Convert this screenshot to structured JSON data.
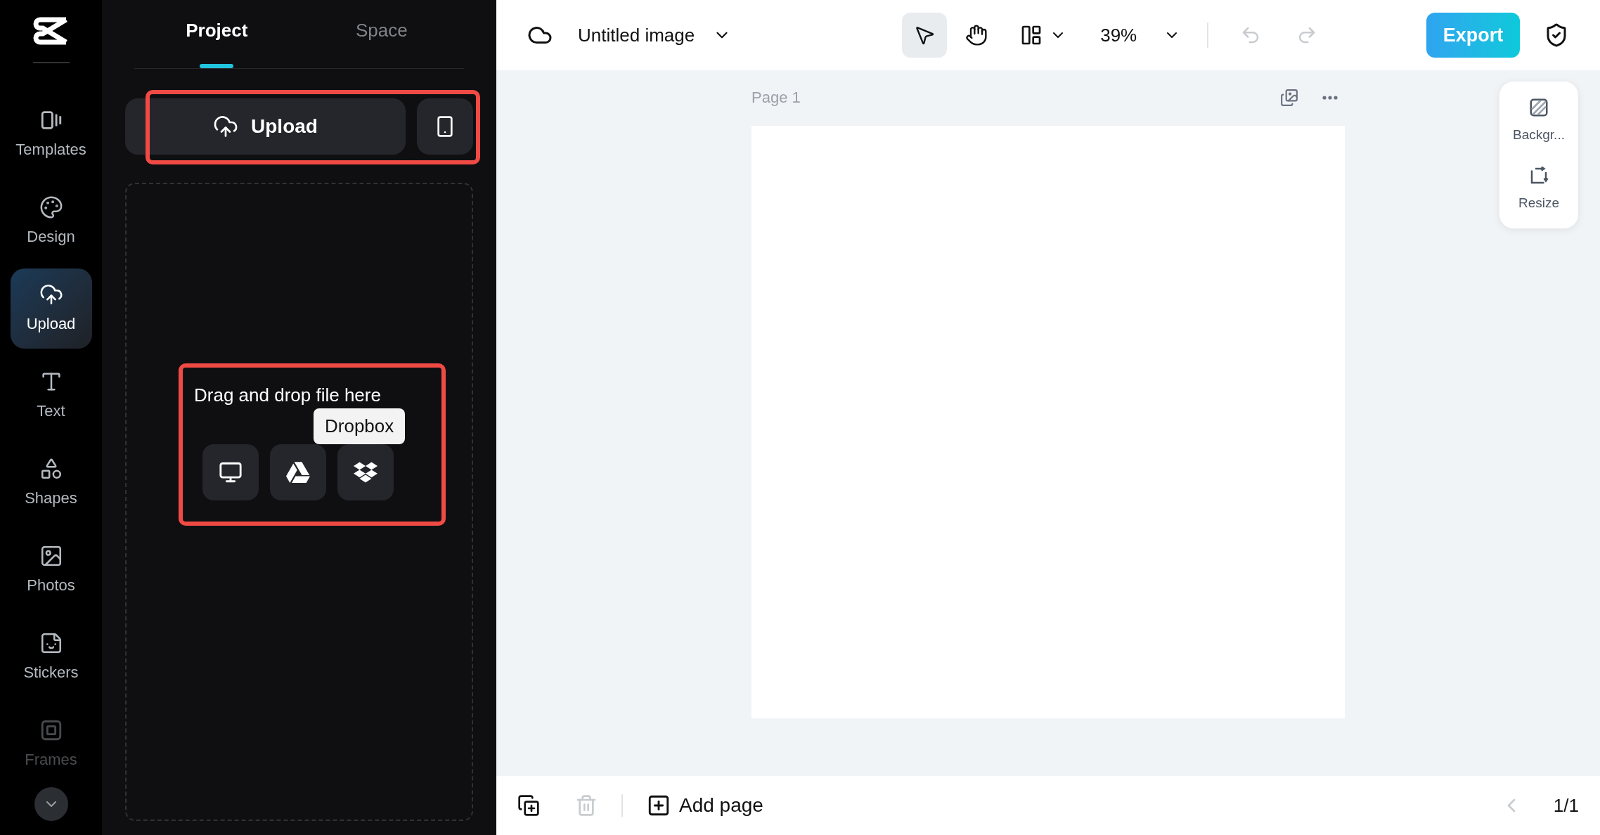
{
  "rail": {
    "items": [
      {
        "kind": "templates",
        "label": "Templates",
        "selected": false,
        "disabled": false
      },
      {
        "kind": "design",
        "label": "Design",
        "selected": false,
        "disabled": false
      },
      {
        "kind": "upload",
        "label": "Upload",
        "selected": true,
        "disabled": false
      },
      {
        "kind": "text",
        "label": "Text",
        "selected": false,
        "disabled": false
      },
      {
        "kind": "shapes",
        "label": "Shapes",
        "selected": false,
        "disabled": false
      },
      {
        "kind": "photos",
        "label": "Photos",
        "selected": false,
        "disabled": false
      },
      {
        "kind": "stickers",
        "label": "Stickers",
        "selected": false,
        "disabled": false
      },
      {
        "kind": "frames",
        "label": "Frames",
        "selected": false,
        "disabled": true
      }
    ]
  },
  "panel": {
    "tabs": [
      {
        "label": "Project",
        "selected": true
      },
      {
        "label": "Space",
        "selected": false
      }
    ],
    "upload_button": "Upload",
    "dropzone": {
      "text": "Drag and drop file here",
      "sources": [
        {
          "kind": "computer"
        },
        {
          "kind": "drive"
        },
        {
          "kind": "dropbox"
        }
      ],
      "tooltip": "Dropbox"
    }
  },
  "toolbar": {
    "title": "Untitled image",
    "tools": [
      {
        "kind": "select",
        "selected": true
      },
      {
        "kind": "hand",
        "selected": false
      }
    ],
    "zoom": "39%",
    "undo_disabled": true,
    "redo_disabled": true,
    "export": "Export"
  },
  "canvas": {
    "page_label": "Page 1"
  },
  "side_tools": [
    {
      "kind": "background",
      "label": "Backgr..."
    },
    {
      "kind": "resize",
      "label": "Resize"
    }
  ],
  "bottom_bar": {
    "delete_disabled": true,
    "add_page": "Add page",
    "prev_disabled": true,
    "page_count": "1/1"
  }
}
